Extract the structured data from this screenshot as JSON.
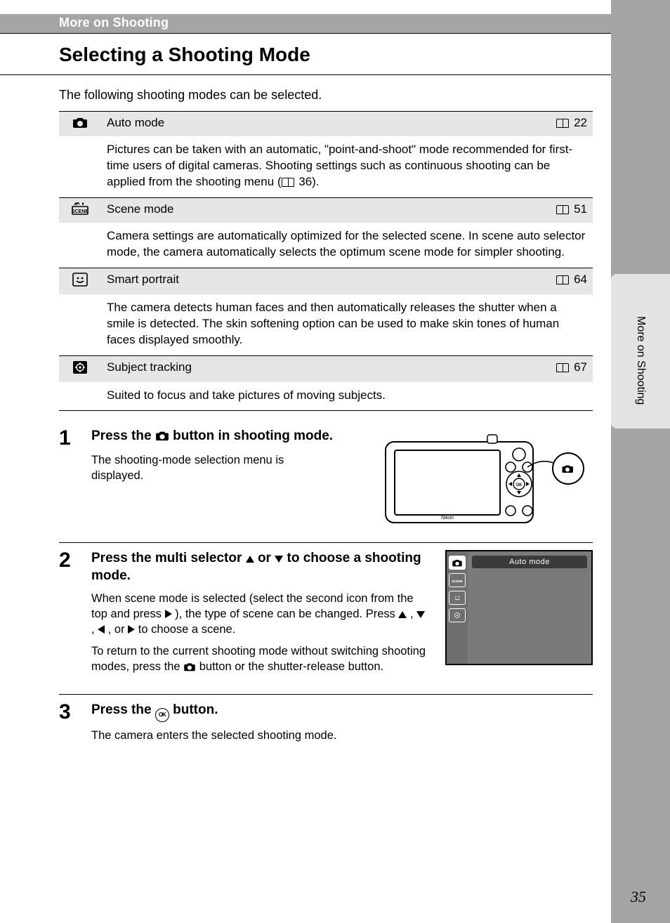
{
  "section_label": "More on Shooting",
  "page_title": "Selecting a Shooting Mode",
  "intro": "The following shooting modes can be selected.",
  "side_tab": "More on Shooting",
  "page_number": "35",
  "modes": [
    {
      "name": "Auto mode",
      "page": "22",
      "desc_a": "Pictures can be taken with an automatic, \"point-and-shoot\" mode recommended for first-time users of digital cameras. Shooting settings such as continuous shooting can be applied from the shooting menu (",
      "desc_b": " 36)."
    },
    {
      "name": "Scene mode",
      "page": "51",
      "desc": "Camera settings are automatically optimized for the selected scene. In scene auto selector mode, the camera automatically selects the optimum scene mode for simpler shooting."
    },
    {
      "name": "Smart portrait",
      "page": "64",
      "desc": "The camera detects human faces and then automatically releases the shutter when a smile is detected. The skin softening option can be used to make skin tones of human faces displayed smoothly."
    },
    {
      "name": "Subject tracking",
      "page": "67",
      "desc": "Suited to focus and take pictures of moving subjects."
    }
  ],
  "steps": {
    "s1": {
      "num": "1",
      "head_a": "Press the ",
      "head_b": " button in shooting mode.",
      "text": "The shooting-mode selection menu is displayed."
    },
    "s2": {
      "num": "2",
      "head_a": "Press the multi selector ",
      "head_b": " or ",
      "head_c": " to choose a shooting mode.",
      "text1_a": "When scene mode is selected (select the second icon from the top and press ",
      "text1_b": "), the type of scene can be changed. Press ",
      "text1_c": ", ",
      "text1_d": ", ",
      "text1_e": ", or ",
      "text1_f": " to choose a scene.",
      "text2_a": "To return to the current shooting mode without switching shooting modes, press the ",
      "text2_b": " button or the shutter-release button.",
      "lcd_label": "Auto mode"
    },
    "s3": {
      "num": "3",
      "head_a": "Press the ",
      "head_b": " button.",
      "ok": "OK",
      "text": "The camera enters the selected shooting mode."
    }
  }
}
